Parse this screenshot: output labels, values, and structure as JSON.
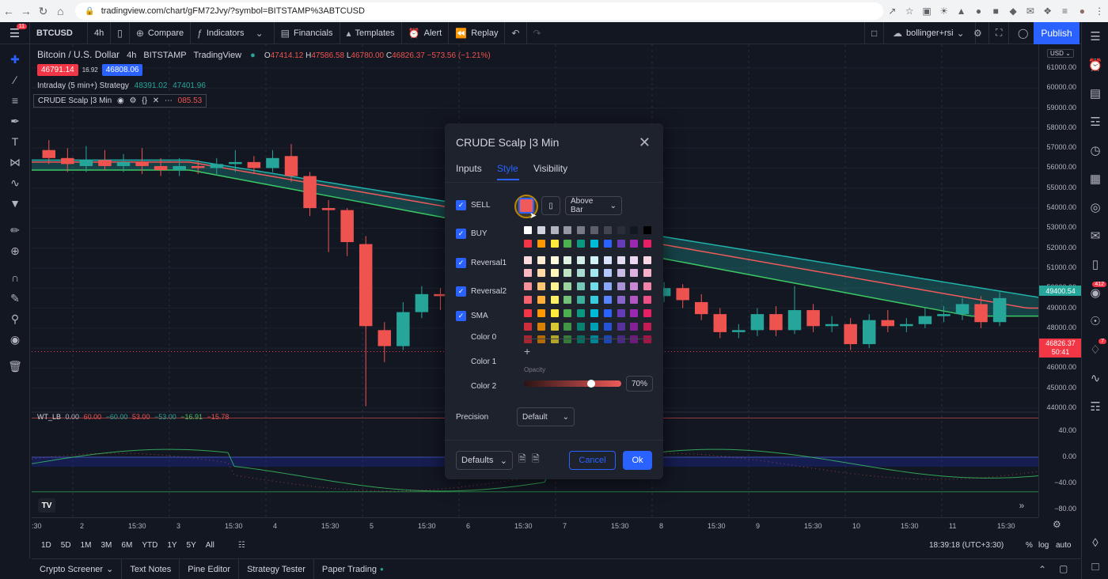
{
  "browser": {
    "url": "tradingview.com/chart/gFM72Jvy/?symbol=BITSTAMP%3ABTCUSD",
    "nav_icons": [
      "back-icon",
      "forward-icon",
      "reload-icon",
      "home-icon"
    ]
  },
  "toolbar": {
    "menu_badge": "11",
    "symbol": "BTCUSD",
    "interval": "4h",
    "compare": "Compare",
    "indicators": "Indicators",
    "financials": "Financials",
    "templates": "Templates",
    "alert": "Alert",
    "replay": "Replay",
    "layout_name": "bollinger+rsi",
    "publish": "Publish"
  },
  "legend": {
    "title": "Bitcoin / U.S. Dollar",
    "interval": "4h",
    "exchange": "BITSTAMP",
    "source": "TradingView",
    "o_label": "O",
    "o": "47414.12",
    "h_label": "H",
    "h": "47586.58",
    "l_label": "L",
    "l": "46780.00",
    "c_label": "C",
    "c": "46826.37",
    "change": "−573.56 (−1.21%)",
    "sell_price": "46791.14",
    "spread": "16.92",
    "buy_price": "46808.06",
    "strategy": "Intraday (5 min+) Strategy",
    "strategy_v1": "48391.02",
    "strategy_v2": "47401.96",
    "indicator_name": "CRUDE Scalp |3 Min",
    "indicator_value": "085.53",
    "osc_name": "WT_LB",
    "osc_values": [
      "0.00",
      "60.00",
      "−60.00",
      "53.00",
      "−53.00",
      "−16.91",
      "−15.78"
    ]
  },
  "price_axis": {
    "currency": "USD",
    "labels": [
      "61000.00",
      "60000.00",
      "59000.00",
      "58000.00",
      "57000.00",
      "56000.00",
      "55000.00",
      "54000.00",
      "53000.00",
      "52000.00",
      "51000.00",
      "50000.00",
      "49000.00",
      "48000.00",
      "47000.00",
      "46000.00",
      "45000.00",
      "44000.00"
    ],
    "tag_upper": "49400.54",
    "tag_price": "46826.37",
    "tag_countdown": "50:41",
    "osc_labels": [
      "40.00",
      "0.00",
      "−40.00",
      "−80.00"
    ]
  },
  "time_axis": {
    "labels": [
      ":30",
      "2",
      "15:30",
      "3",
      "15:30",
      "4",
      "15:30",
      "5",
      "15:30",
      "6",
      "15:30",
      "7",
      "15:30",
      "8",
      "15:30",
      "9",
      "15:30",
      "10",
      "15:30",
      "11",
      "15:30"
    ]
  },
  "range_bar": {
    "ranges": [
      "1D",
      "5D",
      "1M",
      "3M",
      "6M",
      "YTD",
      "1Y",
      "5Y",
      "All"
    ],
    "clock": "18:39:18 (UTC+3:30)",
    "percent": "%",
    "log": "log",
    "auto": "auto"
  },
  "bottom_bar": {
    "tabs": [
      "Crypto Screener",
      "Text Notes",
      "Pine Editor",
      "Strategy Tester",
      "Paper Trading"
    ]
  },
  "dialog": {
    "title": "CRUDE Scalp |3 Min",
    "tabs": [
      "Inputs",
      "Style",
      "Visibility"
    ],
    "active_tab": "Style",
    "plots": [
      {
        "label": "SELL",
        "checked": true
      },
      {
        "label": "BUY",
        "checked": true
      },
      {
        "label": "Reversal1",
        "checked": true
      },
      {
        "label": "Reversal2",
        "checked": true
      },
      {
        "label": "SMA",
        "checked": true
      }
    ],
    "color_rows": [
      "Color 0",
      "Color 1",
      "Color 2"
    ],
    "location": "Above Bar",
    "opacity_label": "Opacity",
    "opacity": "70%",
    "precision_label": "Precision",
    "precision": "Default",
    "defaults": "Defaults",
    "cancel": "Cancel",
    "ok": "Ok"
  },
  "right_badges": {
    "notifications": "412",
    "alerts": "7"
  },
  "colors": {
    "up": "#26a69a",
    "down": "#ef5350",
    "accent": "#2962ff",
    "band": "#20b2aa",
    "ma_red": "#f05a5a",
    "ma_green": "#3cc864"
  },
  "chart_data": {
    "type": "candlestick",
    "title": "Bitcoin / U.S. Dollar",
    "ylim": [
      44000,
      61000
    ],
    "x_ticks": [
      ":30",
      "2",
      "15:30",
      "3",
      "15:30",
      "4",
      "15:30",
      "5",
      "15:30",
      "6",
      "15:30",
      "7",
      "15:30",
      "8",
      "15:30",
      "9",
      "15:30",
      "10",
      "15:30",
      "11",
      "15:30"
    ],
    "candles": [
      {
        "o": 56900,
        "c": 56500,
        "h": 57400,
        "l": 56200
      },
      {
        "o": 56500,
        "c": 56200,
        "h": 57000,
        "l": 55800
      },
      {
        "o": 56100,
        "c": 56400,
        "h": 57100,
        "l": 55800
      },
      {
        "o": 56400,
        "c": 56100,
        "h": 56900,
        "l": 55900
      },
      {
        "o": 56100,
        "c": 56300,
        "h": 56700,
        "l": 55800
      },
      {
        "o": 56300,
        "c": 56100,
        "h": 57000,
        "l": 55700
      },
      {
        "o": 56100,
        "c": 55900,
        "h": 56500,
        "l": 55600
      },
      {
        "o": 55900,
        "c": 56100,
        "h": 56500,
        "l": 55600
      },
      {
        "o": 56100,
        "c": 56000,
        "h": 56400,
        "l": 55700
      },
      {
        "o": 56000,
        "c": 56200,
        "h": 56500,
        "l": 55700
      },
      {
        "o": 56200,
        "c": 56300,
        "h": 56900,
        "l": 55800
      },
      {
        "o": 56300,
        "c": 56000,
        "h": 56600,
        "l": 55700
      },
      {
        "o": 56000,
        "c": 56500,
        "h": 56900,
        "l": 55800
      },
      {
        "o": 56600,
        "c": 55600,
        "h": 57200,
        "l": 55300
      },
      {
        "o": 55600,
        "c": 54000,
        "h": 55800,
        "l": 53600
      },
      {
        "o": 54000,
        "c": 53900,
        "h": 54400,
        "l": 51800
      },
      {
        "o": 53900,
        "c": 52300,
        "h": 54000,
        "l": 51600
      },
      {
        "o": 52200,
        "c": 48100,
        "h": 52600,
        "l": 44100
      },
      {
        "o": 47900,
        "c": 47100,
        "h": 48300,
        "l": 46300
      },
      {
        "o": 47100,
        "c": 48800,
        "h": 49300,
        "l": 46900
      },
      {
        "o": 48800,
        "c": 49700,
        "h": 50100,
        "l": 48500
      },
      {
        "o": 49700,
        "c": 49600,
        "h": 50000,
        "l": 48900
      },
      {
        "o": 49600,
        "c": 49500,
        "h": 50100,
        "l": 49100
      },
      {
        "o": 49500,
        "c": 49700,
        "h": 50100,
        "l": 49100
      },
      {
        "o": 49700,
        "c": 49500,
        "h": 50000,
        "l": 49200
      },
      {
        "o": 49500,
        "c": 48300,
        "h": 49800,
        "l": 47900
      },
      {
        "o": 48300,
        "c": 49400,
        "h": 49800,
        "l": 48000
      },
      {
        "o": 50600,
        "c": 50300,
        "h": 50900,
        "l": 49900
      },
      {
        "o": 50300,
        "c": 49100,
        "h": 50500,
        "l": 48700
      },
      {
        "o": 49100,
        "c": 50700,
        "h": 51000,
        "l": 48800
      },
      {
        "o": 50700,
        "c": 50600,
        "h": 51000,
        "l": 50200
      },
      {
        "o": 50600,
        "c": 50500,
        "h": 50900,
        "l": 50000
      },
      {
        "o": 50500,
        "c": 49600,
        "h": 50700,
        "l": 49200
      },
      {
        "o": 49600,
        "c": 50000,
        "h": 50300,
        "l": 49300
      },
      {
        "o": 50000,
        "c": 49400,
        "h": 50200,
        "l": 49000
      },
      {
        "o": 49300,
        "c": 48700,
        "h": 49700,
        "l": 48400
      },
      {
        "o": 48700,
        "c": 47800,
        "h": 49000,
        "l": 47500
      },
      {
        "o": 47800,
        "c": 47900,
        "h": 48200,
        "l": 47500
      },
      {
        "o": 47900,
        "c": 48700,
        "h": 49000,
        "l": 47600
      },
      {
        "o": 48700,
        "c": 47900,
        "h": 49100,
        "l": 47600
      },
      {
        "o": 47900,
        "c": 48900,
        "h": 50100,
        "l": 47700
      },
      {
        "o": 48900,
        "c": 48100,
        "h": 49200,
        "l": 47800
      },
      {
        "o": 48100,
        "c": 48200,
        "h": 48600,
        "l": 47800
      },
      {
        "o": 48200,
        "c": 47200,
        "h": 48500,
        "l": 46900
      },
      {
        "o": 47200,
        "c": 48400,
        "h": 48700,
        "l": 47000
      },
      {
        "o": 48400,
        "c": 48100,
        "h": 48900,
        "l": 47800
      },
      {
        "o": 48100,
        "c": 48200,
        "h": 48500,
        "l": 47800
      },
      {
        "o": 48200,
        "c": 48600,
        "h": 49000,
        "l": 48000
      },
      {
        "o": 48600,
        "c": 48700,
        "h": 49100,
        "l": 48300
      },
      {
        "o": 48700,
        "c": 49200,
        "h": 49500,
        "l": 48400
      },
      {
        "o": 49200,
        "c": 48300,
        "h": 49600,
        "l": 48000
      },
      {
        "o": 48300,
        "c": 49500,
        "h": 49800,
        "l": 48100
      }
    ]
  }
}
